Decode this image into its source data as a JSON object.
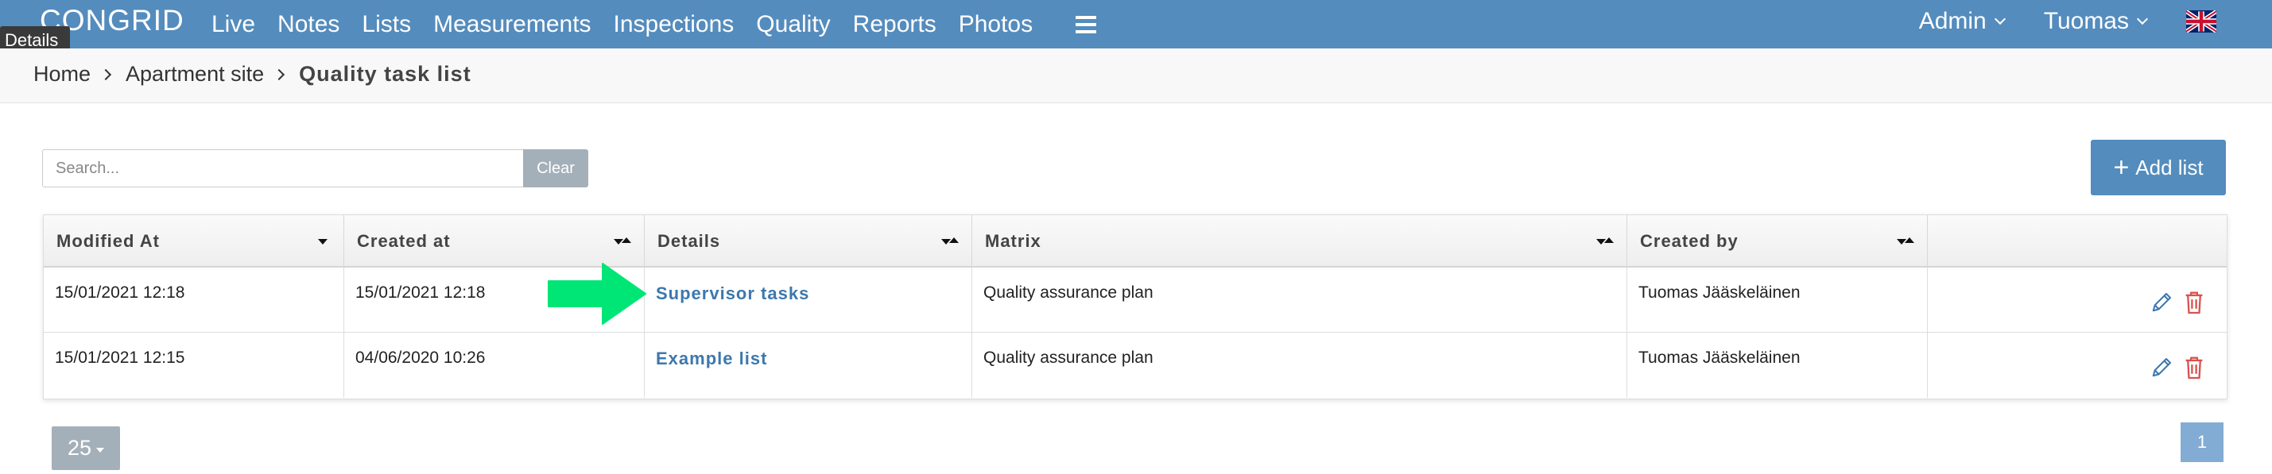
{
  "app": {
    "logo_text": "CONGRID"
  },
  "tooltip": "Details",
  "nav": {
    "items": [
      "Live",
      "Notes",
      "Lists",
      "Measurements",
      "Inspections",
      "Quality",
      "Reports",
      "Photos"
    ],
    "admin_label": "Admin",
    "user_label": "Tuomas"
  },
  "breadcrumb": {
    "home": "Home",
    "site": "Apartment site",
    "current": "Quality task list"
  },
  "search": {
    "placeholder": "Search...",
    "value": ""
  },
  "buttons": {
    "clear": "Clear",
    "add_list": "Add list"
  },
  "table": {
    "columns": [
      "Modified At",
      "Created at",
      "Details",
      "Matrix",
      "Created by",
      ""
    ],
    "rows": [
      {
        "modified_at": "15/01/2021 12:18",
        "created_at": "15/01/2021 12:18",
        "details": "Supervisor tasks",
        "matrix": "Quality assurance plan",
        "created_by": "Tuomas Jääskeläinen"
      },
      {
        "modified_at": "15/01/2021 12:15",
        "created_at": "04/06/2020 10:26",
        "details": "Example list",
        "matrix": "Quality assurance plan",
        "created_by": "Tuomas Jääskeläinen"
      }
    ]
  },
  "pagination": {
    "page_size": "25",
    "current_page": "1"
  },
  "colors": {
    "navbar": "#548cbd",
    "link": "#3c78ad",
    "arrow": "#00e676",
    "delete": "#d9534f"
  }
}
